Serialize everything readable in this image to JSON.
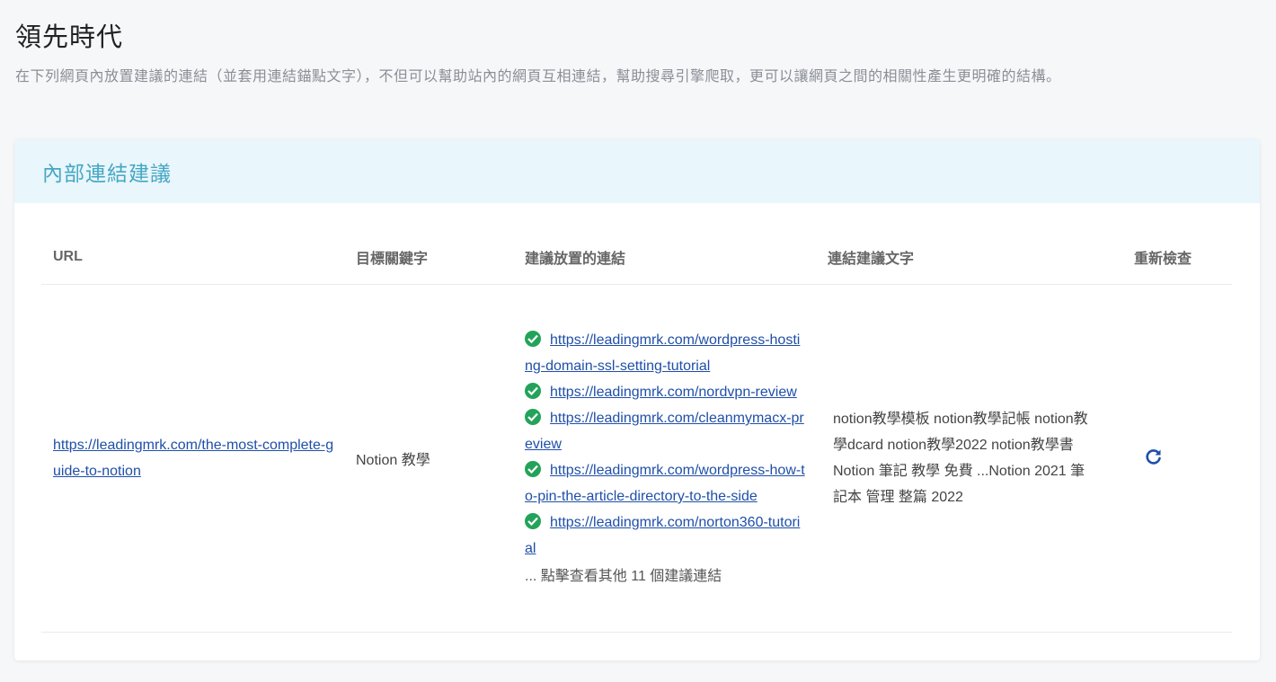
{
  "page": {
    "title": "領先時代",
    "description": "在下列網頁內放置建議的連結（並套用連結錨點文字），不但可以幫助站內的網頁互相連結，幫助搜尋引擎爬取，更可以讓網頁之間的相關性產生更明確的結構。"
  },
  "card": {
    "title": "內部連結建議"
  },
  "table": {
    "headers": {
      "url": "URL",
      "keyword": "目標關鍵字",
      "links": "建議放置的連結",
      "anchor_text": "連結建議文字",
      "recheck": "重新檢查"
    },
    "rows": [
      {
        "url": "https://leadingmrk.com/the-most-complete-guide-to-notion",
        "keyword": "Notion 教學",
        "suggested_links": [
          "https://leadingmrk.com/wordpress-hosting-domain-ssl-setting-tutorial",
          "https://leadingmrk.com/nordvpn-review",
          "https://leadingmrk.com/cleanmymacx-preview",
          "https://leadingmrk.com/wordpress-how-to-pin-the-article-directory-to-the-side",
          "https://leadingmrk.com/norton360-tutorial"
        ],
        "more_links": "... 點擊查看其他 11 個建議連結",
        "anchor_text": "notion教學模板 notion教學記帳 notion教學dcard notion教學2022 notion教學書 Notion 筆記 教學 免費 ...Notion 2021 筆記本 管理 整篇 2022"
      }
    ]
  },
  "colors": {
    "card_title": "#45a7c5",
    "card_header_bg": "#e9f6fb",
    "link": "#1f4fa8",
    "check": "#23a35a"
  },
  "icons": {
    "status": "check-circle-icon",
    "recheck": "refresh-icon"
  }
}
